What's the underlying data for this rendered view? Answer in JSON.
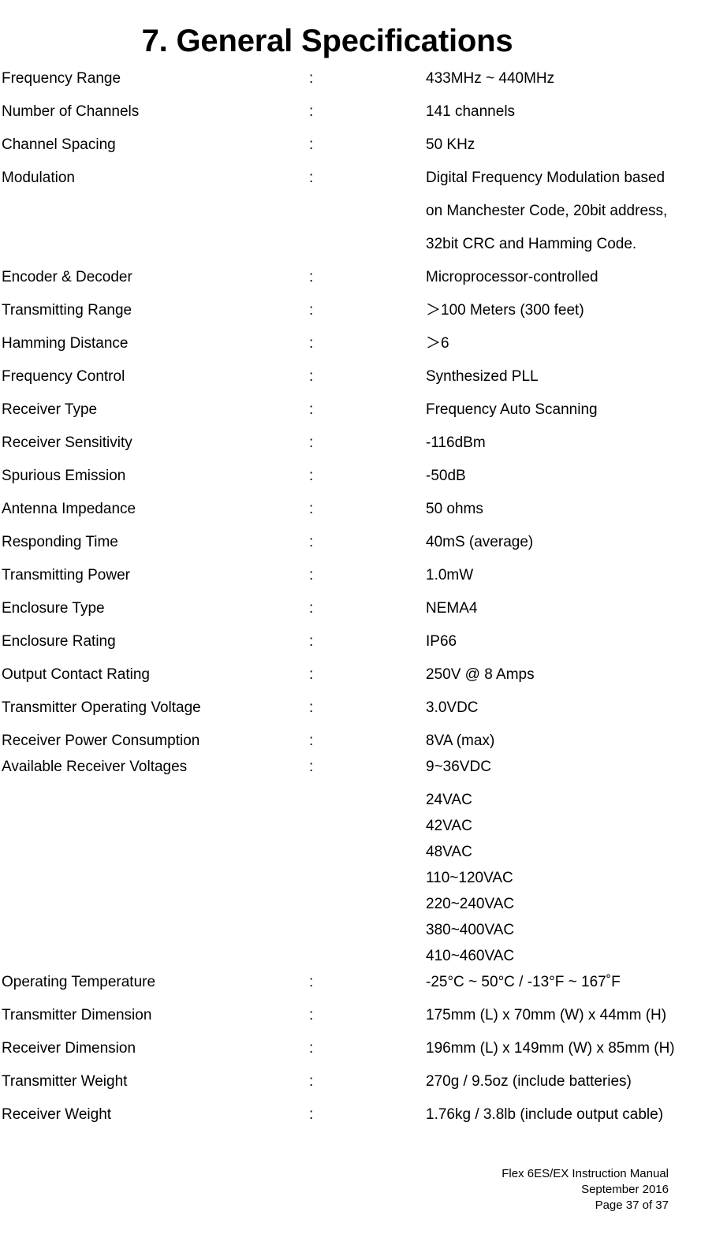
{
  "document": {
    "title": "7. General Specifications"
  },
  "separator": ":",
  "specs": [
    {
      "label": "Frequency Range",
      "value": "433MHz ~ 440MHz"
    },
    {
      "label": "Number of Channels",
      "value": "141 channels"
    },
    {
      "label": "Channel Spacing",
      "value": "50 KHz"
    },
    {
      "label": "Modulation",
      "value": "Digital Frequency Modulation based",
      "continuation": [
        "on Manchester Code, 20bit address,",
        "32bit CRC and Hamming Code."
      ]
    },
    {
      "label": "Encoder & Decoder",
      "value": "Microprocessor-controlled"
    },
    {
      "label": "Transmitting Range",
      "value": "＞100 Meters (300 feet)"
    },
    {
      "label": "Hamming Distance",
      "value": "＞6"
    },
    {
      "label": "Frequency Control",
      "value": "Synthesized PLL"
    },
    {
      "label": "Receiver Type",
      "value": "Frequency Auto Scanning"
    },
    {
      "label": "Receiver Sensitivity",
      "value": "-116dBm"
    },
    {
      "label": "Spurious Emission",
      "value": "-50dB"
    },
    {
      "label": "Antenna Impedance",
      "value": "50 ohms"
    },
    {
      "label": "Responding Time",
      "value": "40mS (average)"
    },
    {
      "label": "Transmitting Power",
      "value": "1.0mW"
    },
    {
      "label": "Enclosure Type",
      "value": "NEMA4"
    },
    {
      "label": "Enclosure Rating",
      "value": "IP66"
    },
    {
      "label": "Output Contact Rating",
      "value": "250V @ 8 Amps"
    },
    {
      "label": "Transmitter Operating Voltage",
      "value": "3.0VDC"
    },
    {
      "label": "Receiver Power Consumption",
      "value": "8VA (max)",
      "tight": true
    },
    {
      "label": "Available Receiver Voltages",
      "value": "9~36VDC",
      "sub": [
        "24VAC",
        "42VAC",
        "48VAC",
        "110~120VAC",
        "220~240VAC",
        "380~400VAC",
        "410~460VAC"
      ]
    },
    {
      "label": "Operating Temperature",
      "value": "-25°C ~ 50°C / -13°F ~ 167˚F"
    },
    {
      "label": "Transmitter Dimension",
      "value": "175mm (L) x 70mm (W) x 44mm (H)"
    },
    {
      "label": "Receiver Dimension",
      "value": "196mm (L) x 149mm (W) x 85mm (H)"
    },
    {
      "label": "Transmitter Weight",
      "value": "270g / 9.5oz (include batteries)"
    },
    {
      "label": "Receiver Weight",
      "value": "1.76kg / 3.8lb (include output cable)"
    }
  ],
  "footer": {
    "line1": "Flex 6ES/EX Instruction Manual",
    "line2": "September 2016",
    "line3": "Page 37 of 37"
  }
}
